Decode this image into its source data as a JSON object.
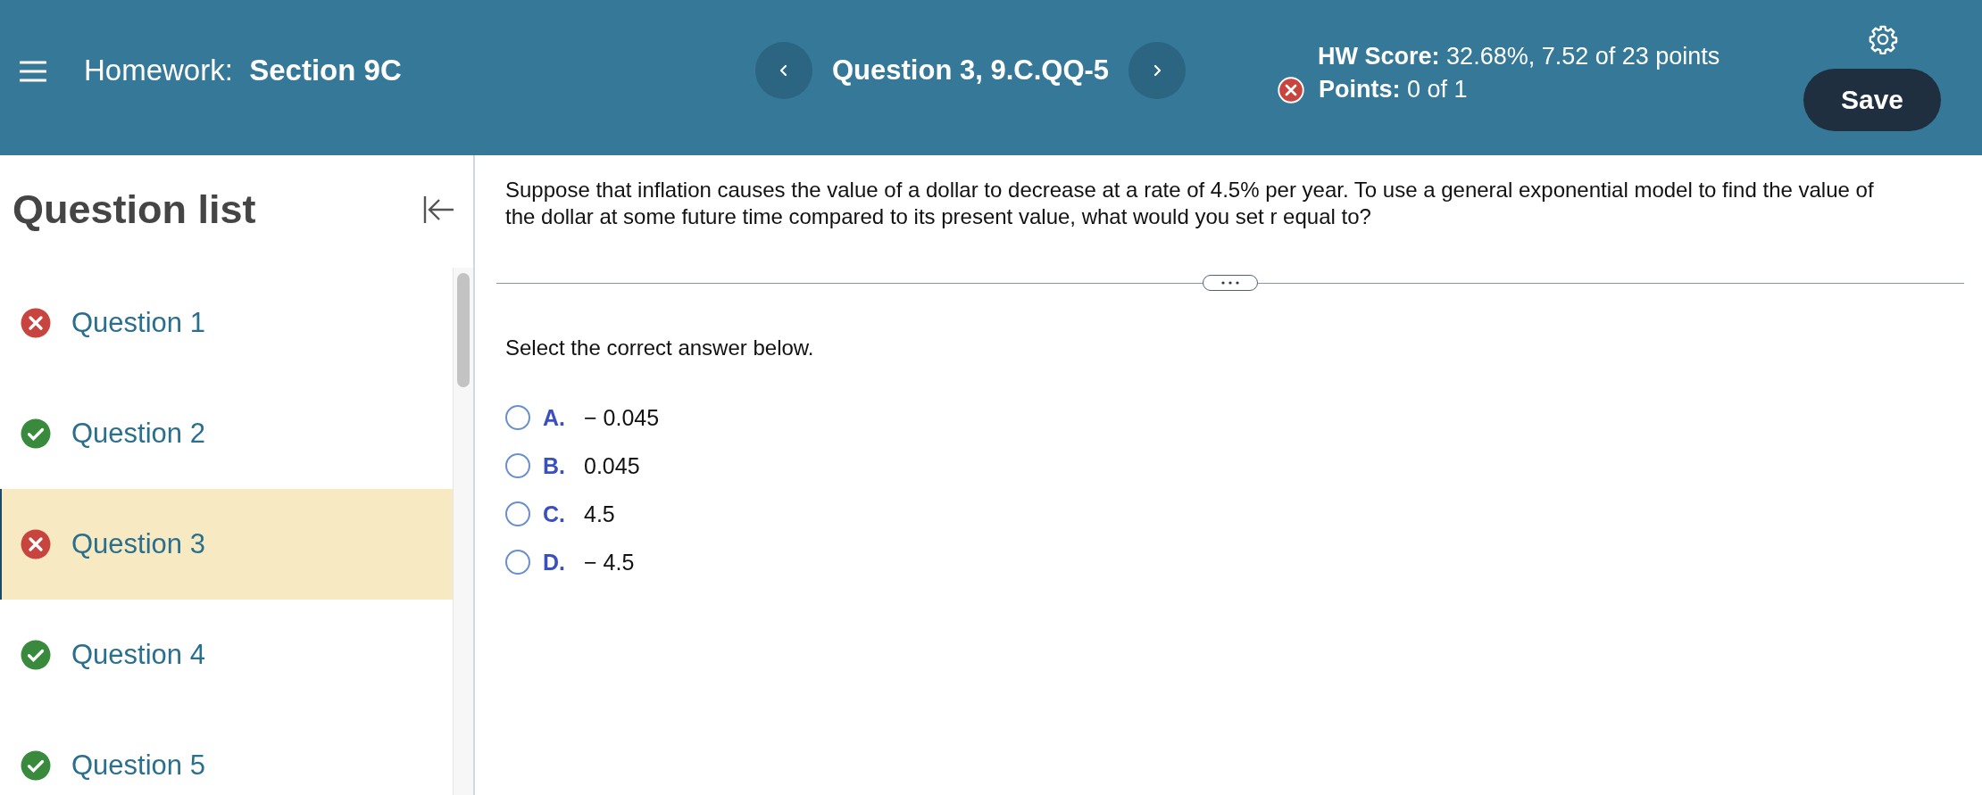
{
  "header": {
    "title_label": "Homework:",
    "title": "Section 9C",
    "question_title": "Question 3, 9.C.QQ-5",
    "hw_score_label": "HW Score:",
    "hw_score": "32.68%, 7.52 of 23 points",
    "points_correct": false,
    "points_label": "Points:",
    "points": "0 of 1",
    "save_button": "Save"
  },
  "sidebar": {
    "title": "Question list",
    "items": [
      {
        "label": "Question 1",
        "correct": false,
        "selected": false
      },
      {
        "label": "Question 2",
        "correct": true,
        "selected": false
      },
      {
        "label": "Question 3",
        "correct": false,
        "selected": true
      },
      {
        "label": "Question 4",
        "correct": true,
        "selected": false
      },
      {
        "label": "Question 5",
        "correct": true,
        "selected": false
      }
    ]
  },
  "question": {
    "prompt": "Suppose that inflation causes the value of a dollar to decrease at a rate of 4.5% per year. To use a general exponential model to find the value of the dollar at some future time compared to its present value, what would you set r equal to?",
    "instruction": "Select the correct answer below.",
    "options": [
      {
        "letter": "A.",
        "text": "− 0.045",
        "selected": false
      },
      {
        "letter": "B.",
        "text": "0.045",
        "selected": false
      },
      {
        "letter": "C.",
        "text": "4.5",
        "selected": false
      },
      {
        "letter": "D.",
        "text": "− 4.5",
        "selected": false
      }
    ]
  }
}
